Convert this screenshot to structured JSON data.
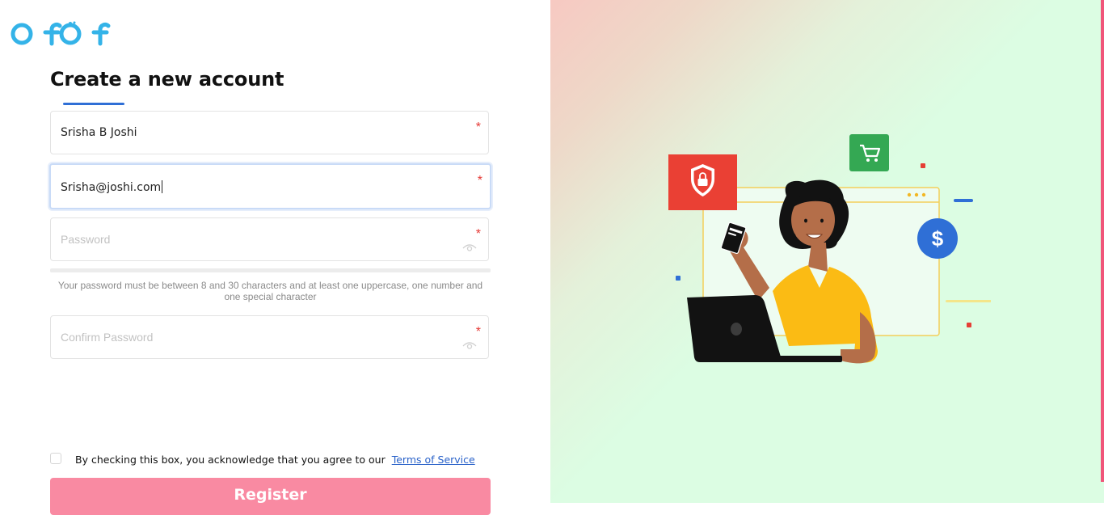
{
  "brand": {
    "logo_text": "ofofo"
  },
  "form": {
    "title": "Create a new account",
    "name": {
      "value": "Srisha B Joshi",
      "required_mark": "*"
    },
    "email": {
      "value": "Srisha@joshi.com",
      "required_mark": "*"
    },
    "password": {
      "placeholder": "Password",
      "required_mark": "*"
    },
    "password_hint": "Your password must be between 8 and 30 characters and at least one uppercase, one number and one special character",
    "confirm_password": {
      "placeholder": "Confirm Password",
      "required_mark": "*"
    },
    "agreement": {
      "text": "By checking this box, you acknowledge that you agree to our",
      "link": "Terms of Service",
      "checked": false
    },
    "submit_label": "Register"
  },
  "colors": {
    "brand_blue": "#34b3e8",
    "accent_blue": "#2f6fd6",
    "required_red": "#e53935",
    "register_pink": "#f98aa2",
    "panel_mint": "#dcfde3"
  },
  "illustration": {
    "icons": [
      "shield-lock-icon",
      "shopping-cart-icon",
      "dollar-icon",
      "credit-card-icon",
      "laptop-icon"
    ]
  }
}
